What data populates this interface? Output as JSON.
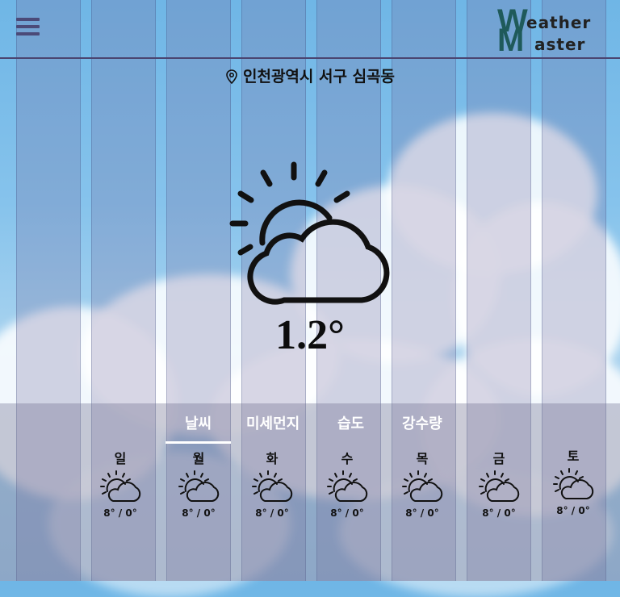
{
  "header": {
    "logo_text_top": "eather",
    "logo_text_bottom": "aster",
    "logo_letter_top": "W",
    "logo_letter_bottom": "M"
  },
  "location": {
    "text": "인천광역시 서구 심곡동"
  },
  "current": {
    "temperature": "1.2°",
    "condition_icon": "partly-cloudy-icon"
  },
  "tabs": [
    {
      "label": "날씨",
      "active": true
    },
    {
      "label": "미세먼지",
      "active": false
    },
    {
      "label": "습도",
      "active": false
    },
    {
      "label": "강수량",
      "active": false
    }
  ],
  "forecast": [
    {
      "day": "일",
      "icon": "partly-cloudy-icon",
      "range": "8° / 0°"
    },
    {
      "day": "월",
      "icon": "partly-cloudy-icon",
      "range": "8° / 0°"
    },
    {
      "day": "화",
      "icon": "partly-cloudy-icon",
      "range": "8° / 0°"
    },
    {
      "day": "수",
      "icon": "partly-cloudy-icon",
      "range": "8° / 0°"
    },
    {
      "day": "목",
      "icon": "partly-cloudy-icon",
      "range": "8° / 0°"
    },
    {
      "day": "금",
      "icon": "partly-cloudy-icon",
      "range": "8° / 0°"
    },
    {
      "day": "토",
      "icon": "partly-cloudy-icon",
      "range": "8° / 0°"
    }
  ],
  "colors": {
    "accent": "#4b4a78",
    "logo": "#1f5a5a",
    "tab_text": "#ffffff"
  }
}
